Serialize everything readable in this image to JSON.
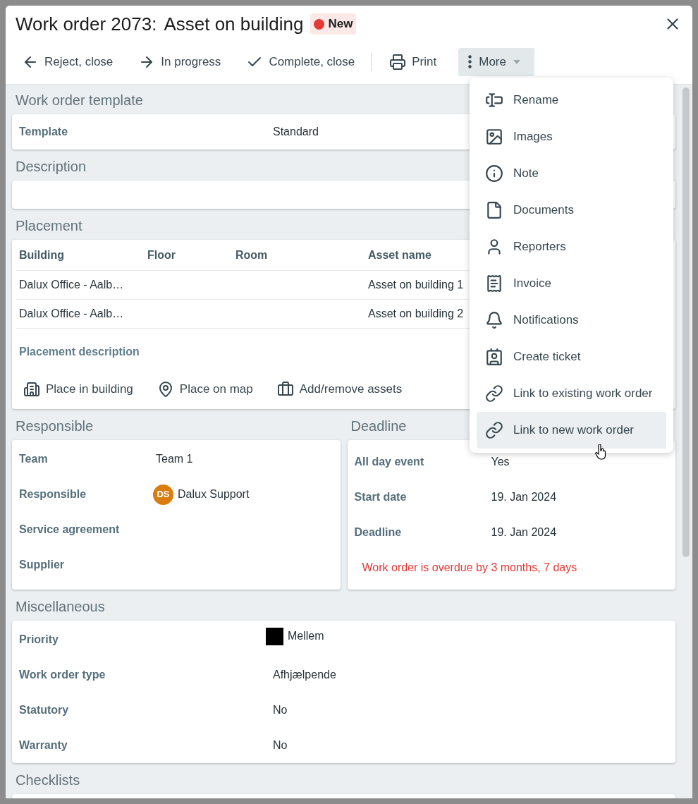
{
  "dialog": {
    "title": "Work order 2073:",
    "subtitle": "Asset on building",
    "status": {
      "label": "New",
      "color": "#e53935"
    }
  },
  "toolbar": {
    "actions": [
      {
        "label": "Reject, close"
      },
      {
        "label": "In progress"
      },
      {
        "label": "Complete, close"
      }
    ],
    "print": {
      "label": "Print"
    },
    "more": {
      "label": "More",
      "expanded": true
    }
  },
  "menu": [
    {
      "label": "Rename",
      "highlighted": false
    },
    {
      "label": "Images",
      "highlighted": false
    },
    {
      "label": "Note",
      "highlighted": false
    },
    {
      "label": "Documents",
      "highlighted": false
    },
    {
      "label": "Reporters",
      "highlighted": false
    },
    {
      "label": "Invoice",
      "highlighted": false
    },
    {
      "label": "Notifications",
      "highlighted": false
    },
    {
      "label": "Create ticket",
      "highlighted": false
    },
    {
      "label": "Link to existing work order",
      "highlighted": false
    },
    {
      "label": "Link to new work order",
      "highlighted": true
    }
  ],
  "template": {
    "heading": "Work order template",
    "rows": [
      {
        "label": "Template",
        "value": "Standard"
      }
    ]
  },
  "description": {
    "heading": "Description"
  },
  "placement": {
    "heading": "Placement",
    "columns": [
      "Building",
      "Floor",
      "Room",
      "Asset name"
    ],
    "rows": [
      [
        "Dalux Office - Aalb…",
        "",
        "",
        "Asset on building 1"
      ],
      [
        "Dalux Office - Aalb…",
        "",
        "",
        "Asset on building 2"
      ]
    ],
    "description_label": "Placement description",
    "actions": [
      {
        "label": "Place in building"
      },
      {
        "label": "Place on map"
      },
      {
        "label": "Add/remove assets"
      }
    ]
  },
  "responsible": {
    "heading": "Responsible",
    "rows": [
      {
        "label": "Team",
        "value": "Team 1"
      },
      {
        "label": "Responsible",
        "value": "Dalux Support",
        "avatar": {
          "initials": "DS",
          "color": "#d97d0f"
        }
      },
      {
        "label": "Service agreement"
      },
      {
        "label": "Supplier"
      }
    ]
  },
  "deadline": {
    "heading": "Deadline",
    "rows": [
      {
        "label": "All day event",
        "value": "Yes"
      },
      {
        "label": "Start date",
        "value": "19. Jan 2024"
      },
      {
        "label": "Deadline",
        "value": "19. Jan 2024"
      }
    ],
    "warning": "Work order is overdue by 3 months, 7 days"
  },
  "miscellaneous": {
    "heading": "Miscellaneous",
    "rows": [
      {
        "label": "Priority",
        "value": "Mellem",
        "color": "#000000"
      },
      {
        "label": "Work order type",
        "value": "Afhjælpende"
      },
      {
        "label": "Statutory",
        "value": "No"
      },
      {
        "label": "Warranty",
        "value": "No"
      }
    ]
  },
  "checklists": {
    "heading": "Checklists"
  }
}
